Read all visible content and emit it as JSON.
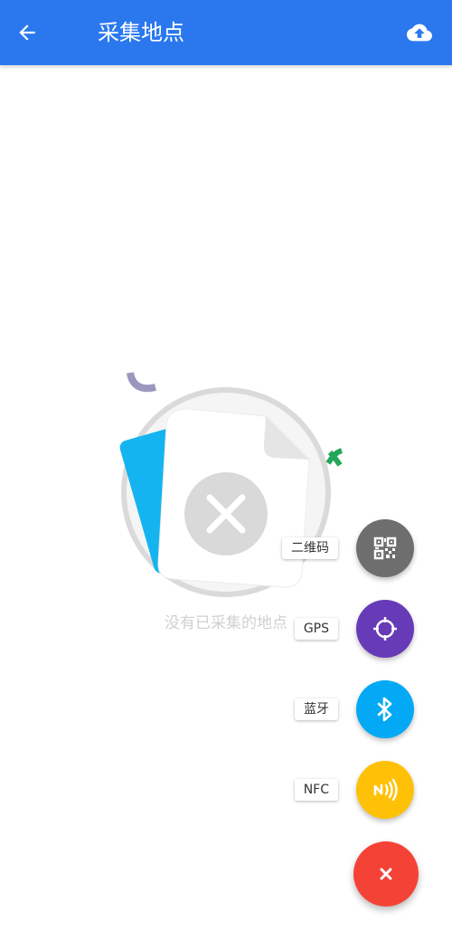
{
  "appbar": {
    "title": "采集地点",
    "back_icon": "arrow-back-icon",
    "upload_icon": "cloud-upload-icon",
    "color": "#2b78ee"
  },
  "empty_state": {
    "message": "没有已采集的地点",
    "icon": "empty-documents-icon"
  },
  "fab_menu": {
    "items": [
      {
        "label": "二维码",
        "icon": "qr-code-icon",
        "color": "#6e6e6e"
      },
      {
        "label": "GPS",
        "icon": "gps-crosshair-icon",
        "color": "#673ab7"
      },
      {
        "label": "蓝牙",
        "icon": "bluetooth-icon",
        "color": "#03a9f4"
      },
      {
        "label": "NFC",
        "icon": "nfc-icon",
        "color": "#ffc107"
      }
    ],
    "close_icon": "close-icon",
    "close_color": "#f44336"
  }
}
